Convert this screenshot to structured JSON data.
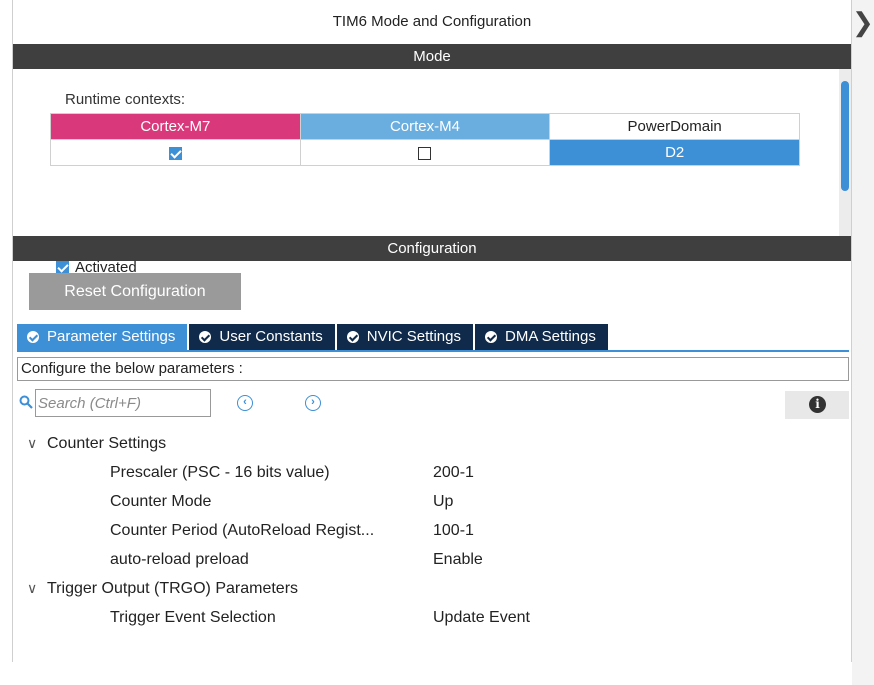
{
  "window": {
    "title": "TIM6 Mode and Configuration"
  },
  "mode": {
    "header": "Mode",
    "runtime_label": "Runtime contexts:",
    "contexts": [
      {
        "name": "Cortex-M7",
        "checked": true,
        "color": "#d9397a"
      },
      {
        "name": "Cortex-M4",
        "checked": false,
        "color": "#6aaee0"
      }
    ],
    "power_domain": {
      "header": "PowerDomain",
      "value": "D2"
    },
    "activated": {
      "label": "Activated",
      "checked": true
    }
  },
  "configuration": {
    "header": "Configuration",
    "reset_label": "Reset Configuration",
    "tabs": [
      {
        "label": "Parameter Settings",
        "active": true
      },
      {
        "label": "User Constants",
        "active": false
      },
      {
        "label": "NVIC Settings",
        "active": false
      },
      {
        "label": "DMA Settings",
        "active": false
      }
    ],
    "describe": "Configure the below parameters :",
    "search": {
      "placeholder": "Search (Ctrl+F)",
      "value": ""
    },
    "groups": [
      {
        "name": "Counter Settings",
        "params": [
          {
            "name": "Prescaler (PSC - 16 bits value)",
            "value": "200-1"
          },
          {
            "name": "Counter Mode",
            "value": "Up"
          },
          {
            "name": "Counter Period (AutoReload Regist...",
            "value": "100-1"
          },
          {
            "name": "auto-reload preload",
            "value": "Enable"
          }
        ]
      },
      {
        "name": "Trigger Output (TRGO) Parameters",
        "params": [
          {
            "name": "Trigger Event Selection",
            "value": "Update Event"
          }
        ]
      }
    ]
  },
  "colors": {
    "accent": "#3d8fd6",
    "dark_tab": "#0f2a4a",
    "section_bar": "#3f3f3f",
    "m7": "#d9397a"
  }
}
